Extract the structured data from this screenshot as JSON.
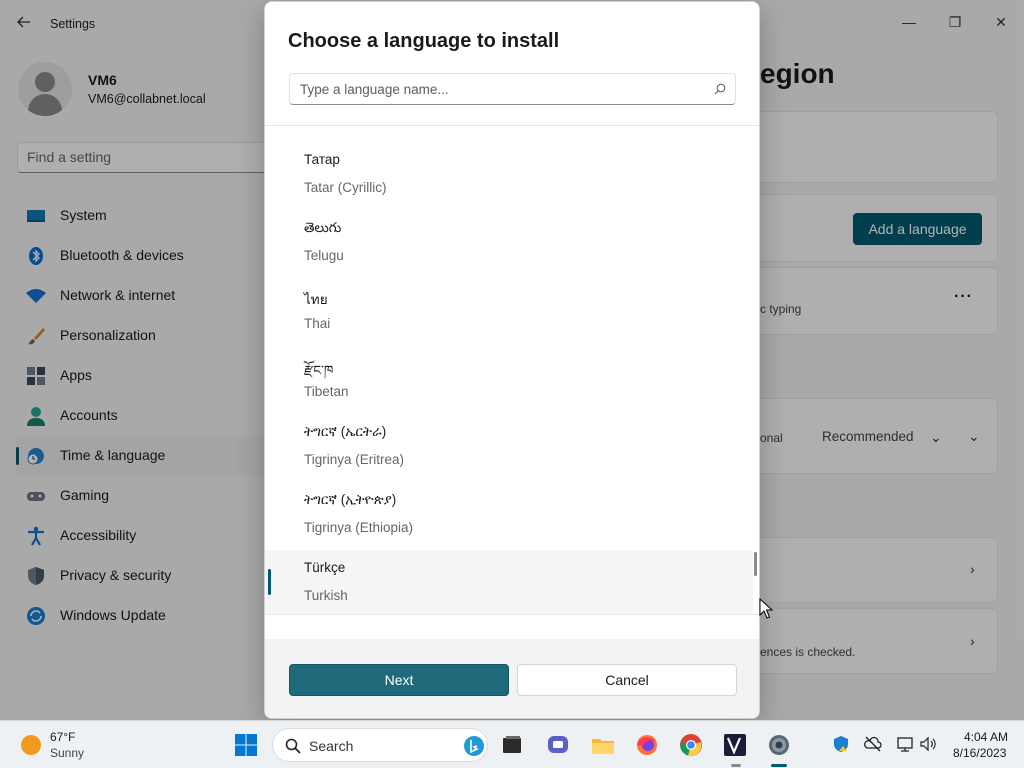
{
  "window": {
    "title": "Settings",
    "minimize_glyph": "—",
    "maximize_glyph": "❐",
    "close_glyph": "✕"
  },
  "profile": {
    "name": "VM6",
    "email": "VM6@collabnet.local"
  },
  "find_setting": {
    "placeholder": "Find a setting"
  },
  "sidebar": {
    "items": [
      {
        "label": "System",
        "icon": "monitor-icon"
      },
      {
        "label": "Bluetooth & devices",
        "icon": "bluetooth-icon"
      },
      {
        "label": "Network & internet",
        "icon": "wifi-icon"
      },
      {
        "label": "Personalization",
        "icon": "brush-icon"
      },
      {
        "label": "Apps",
        "icon": "apps-icon"
      },
      {
        "label": "Accounts",
        "icon": "person-icon"
      },
      {
        "label": "Time & language",
        "icon": "globe-clock-icon",
        "active": true
      },
      {
        "label": "Gaming",
        "icon": "gamepad-icon"
      },
      {
        "label": "Accessibility",
        "icon": "accessibility-icon"
      },
      {
        "label": "Privacy & security",
        "icon": "shield-icon"
      },
      {
        "label": "Windows Update",
        "icon": "update-icon"
      }
    ]
  },
  "main": {
    "title_fragment": "egion",
    "add_language_label": "Add a language",
    "typing_fragment": "c typing",
    "optional_fragment": "onal",
    "recommended_label": "Recommended",
    "checked_fragment": "ences is checked."
  },
  "dialog": {
    "title": "Choose a language to install",
    "search_placeholder": "Type a language name...",
    "languages": [
      {
        "native": "Татар",
        "english": "Tatar (Cyrillic)"
      },
      {
        "native": "తెలుగు",
        "english": "Telugu"
      },
      {
        "native": "ไทย",
        "english": "Thai"
      },
      {
        "native": "རྫོང་ཁ",
        "english": "Tibetan"
      },
      {
        "native": "ትግርኛ (ኤርትራ)",
        "english": "Tigrinya (Eritrea)"
      },
      {
        "native": "ትግርኛ (ኢትዮጵያ)",
        "english": "Tigrinya (Ethiopia)"
      },
      {
        "native": "Türkçe",
        "english": "Turkish",
        "selected": true
      }
    ],
    "next_label": "Next",
    "cancel_label": "Cancel"
  },
  "taskbar": {
    "weather": {
      "temp": "67°F",
      "condition": "Sunny"
    },
    "search_label": "Search",
    "apps": [
      "windows-start-icon",
      "bing-icon",
      "terminal-icon",
      "teams-chat-icon",
      "file-explorer-icon",
      "firefox-icon",
      "chrome-icon",
      "vscode-icon",
      "settings-gear-icon"
    ],
    "clock": {
      "time": "4:04 AM",
      "date": "8/16/2023"
    }
  },
  "colors": {
    "accent": "#005a70",
    "next_button": "#1e6a7b",
    "weather_sun": "#f29a1f"
  }
}
